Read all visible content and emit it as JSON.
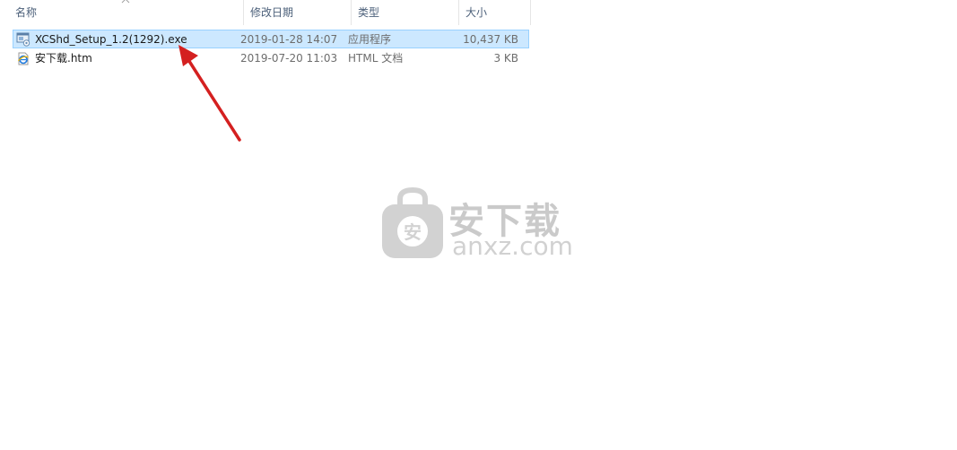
{
  "columns": {
    "name": "名称",
    "date": "修改日期",
    "type": "类型",
    "size": "大小"
  },
  "files": [
    {
      "name": "XCShd_Setup_1.2(1292).exe",
      "date": "2019-01-28 14:07",
      "type": "应用程序",
      "size": "10,437 KB",
      "icon": "exe-installer-icon",
      "selected": true
    },
    {
      "name": "安下载.htm",
      "date": "2019-07-20 11:03",
      "type": "HTML 文档",
      "size": "3 KB",
      "icon": "ie-html-icon",
      "selected": false
    }
  ],
  "watermark": {
    "cn": "安下载",
    "en": "anxz.com",
    "badge": "安"
  },
  "colors": {
    "selection_bg": "#cce8ff",
    "selection_border": "#99d1ff",
    "arrow": "#d42020"
  }
}
